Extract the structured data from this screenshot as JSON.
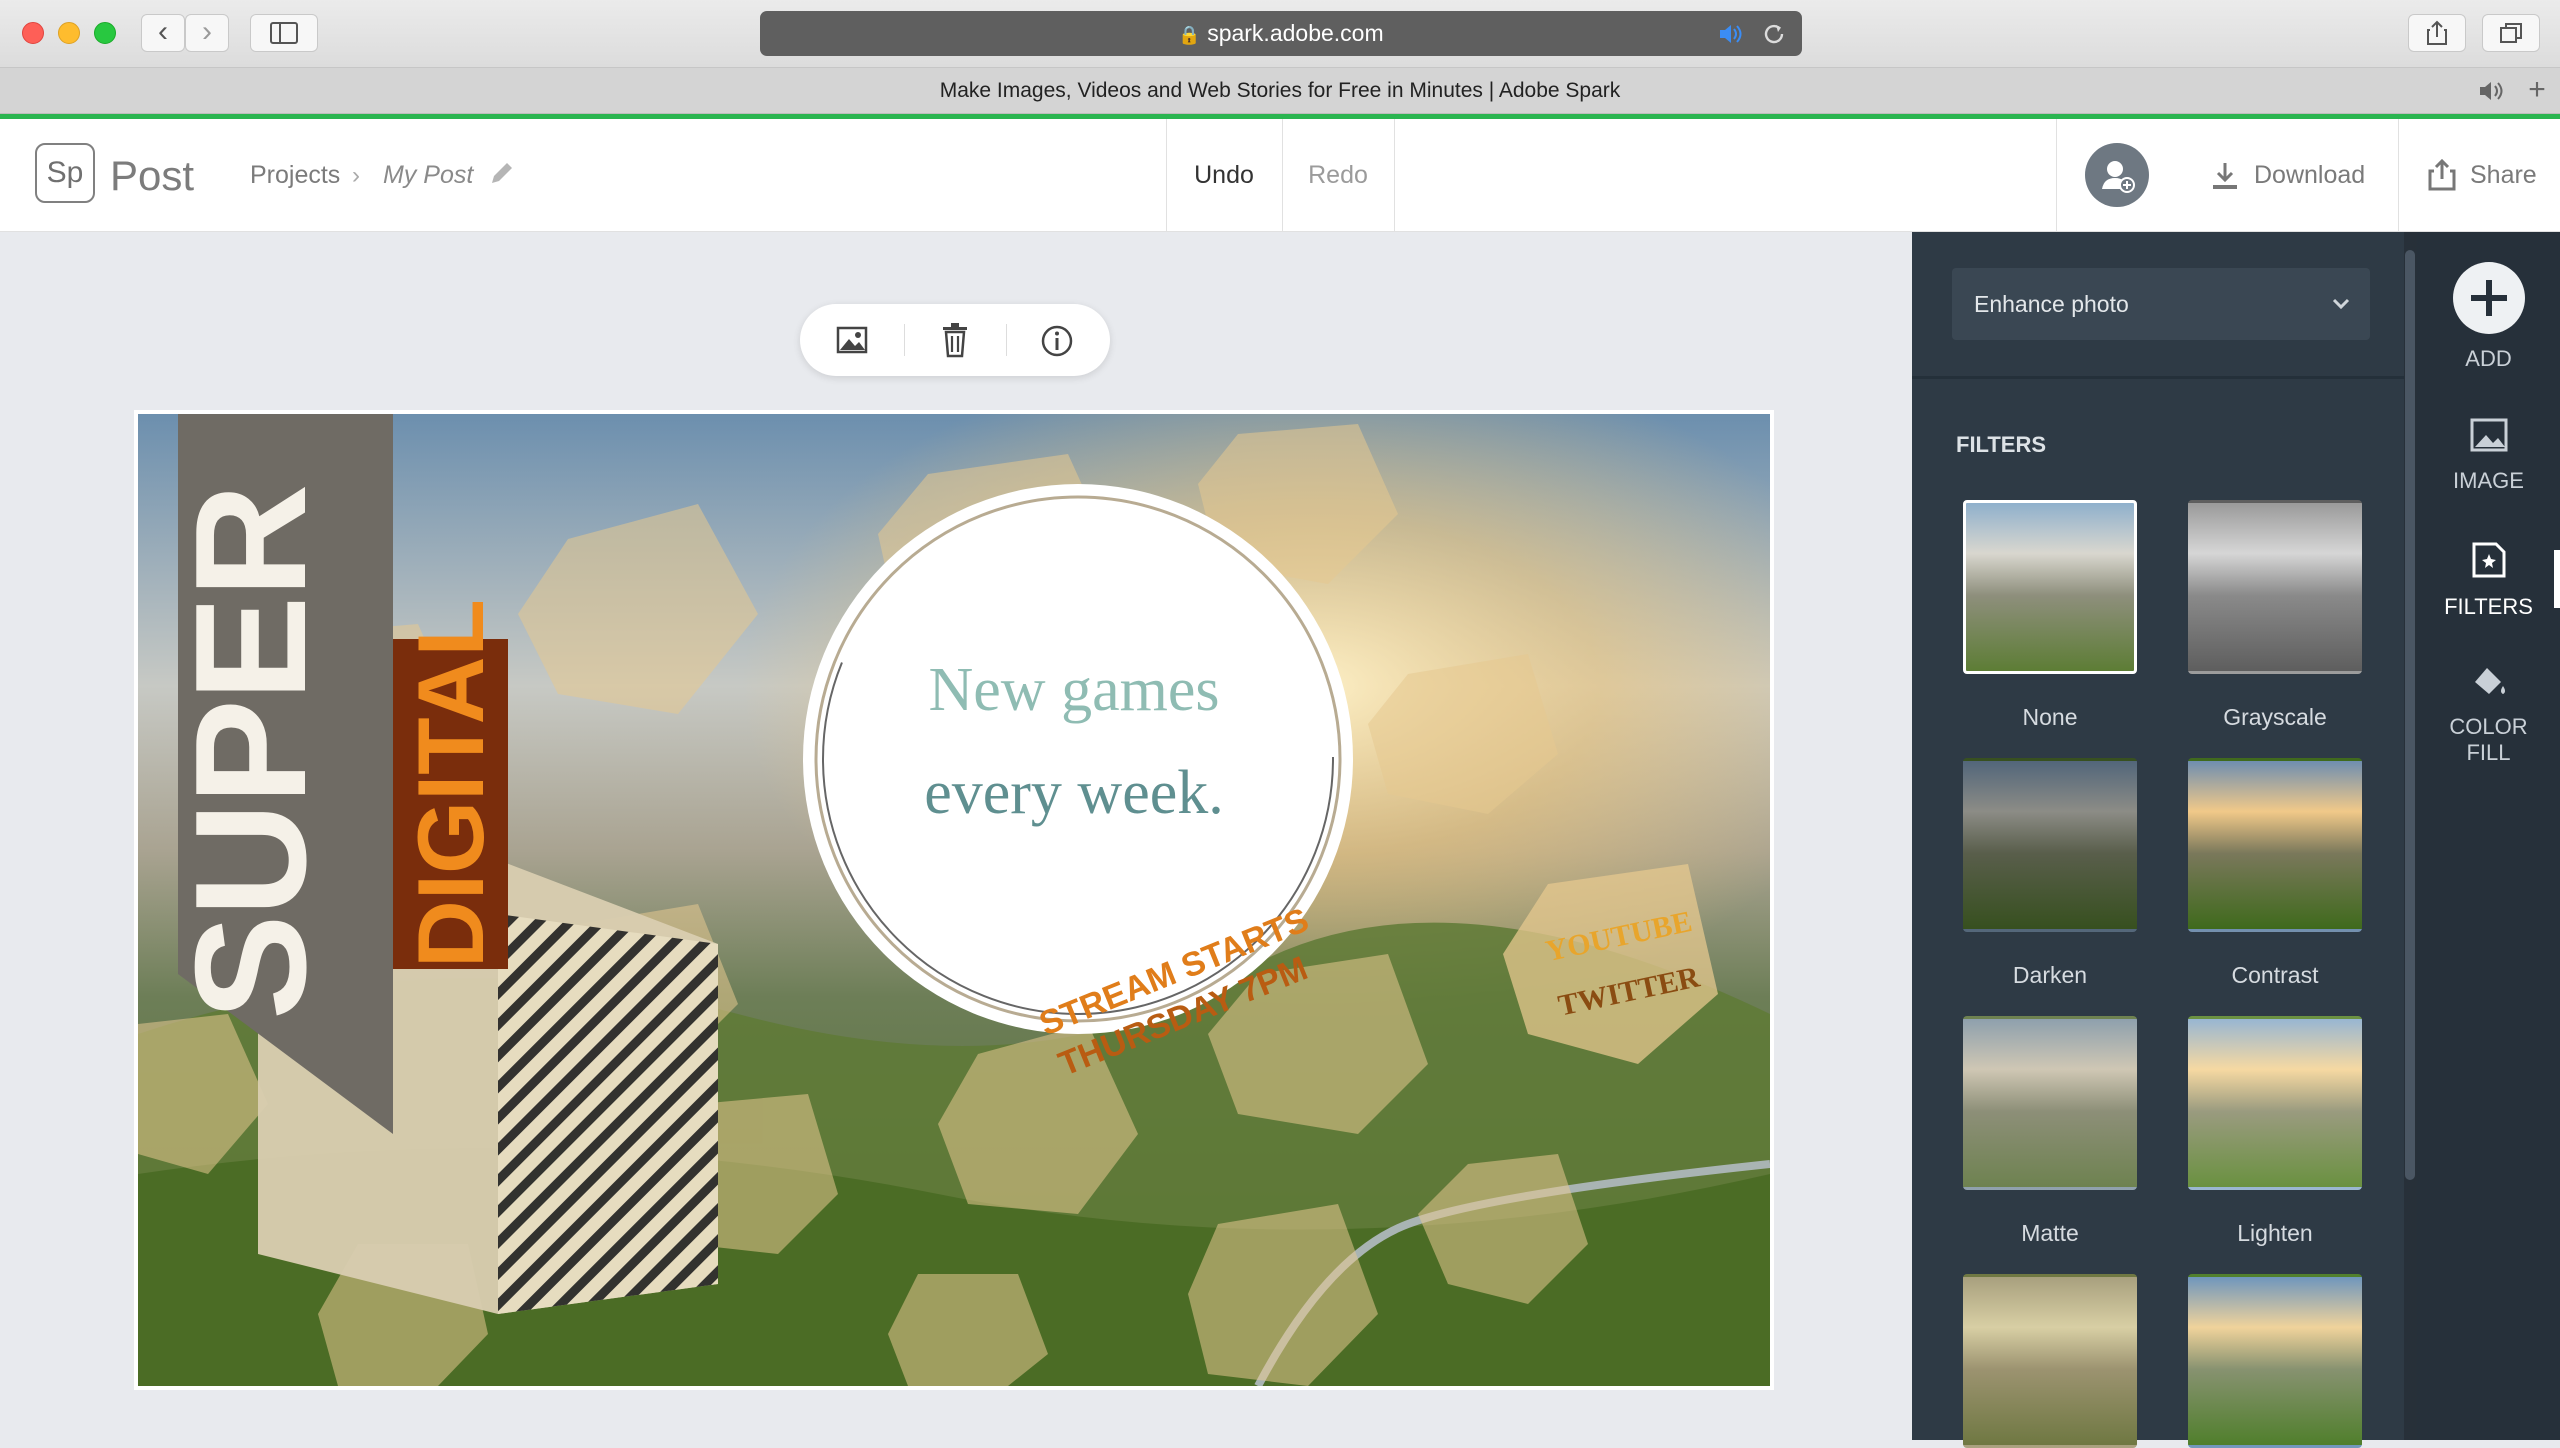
{
  "browser": {
    "url": "spark.adobe.com",
    "tab_title": "Make Images, Videos and Web Stories for Free in Minutes | Adobe Spark"
  },
  "header": {
    "logo_text": "Sp",
    "app_name": "Post",
    "breadcrumb_projects": "Projects",
    "breadcrumb_post": "My Post",
    "undo": "Undo",
    "redo": "Redo",
    "download": "Download",
    "share": "Share"
  },
  "canvas": {
    "title_super": "SUPER",
    "title_digital": "DIGITAL",
    "circle_line1": "New games",
    "circle_line2": "every week.",
    "stream_line1": "STREAM STARTS",
    "stream_line2": "THURSDAY 7PM",
    "hex_line1": "YOUTUBE",
    "hex_line2": "TWITTER"
  },
  "panel": {
    "dropdown": "Enhance photo",
    "section_title": "FILTERS",
    "filters": [
      {
        "label": "None"
      },
      {
        "label": "Grayscale"
      },
      {
        "label": "Darken"
      },
      {
        "label": "Contrast"
      },
      {
        "label": "Matte"
      },
      {
        "label": "Lighten"
      }
    ]
  },
  "rail": {
    "add": "ADD",
    "image": "IMAGE",
    "filters": "FILTERS",
    "color_fill_1": "COLOR",
    "color_fill_2": "FILL"
  },
  "colors": {
    "accent_green": "#2ab550",
    "panel_bg": "#2e3a45",
    "rail_bg": "#26303a",
    "orange_text": "#e8851e"
  }
}
